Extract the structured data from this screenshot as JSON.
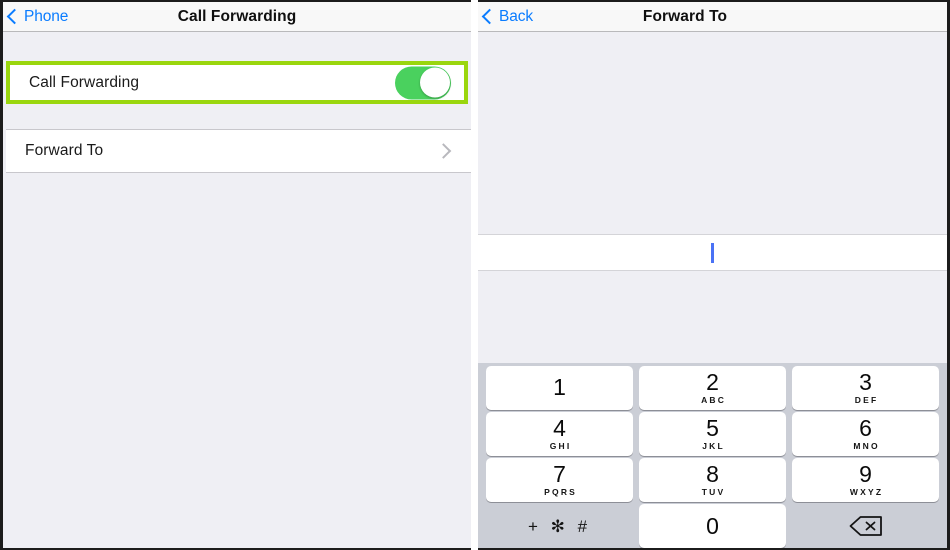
{
  "left_panel": {
    "nav": {
      "back_label": "Phone",
      "back_icon": "chevron-left-icon",
      "title": "Call Forwarding"
    },
    "rows": {
      "call_forwarding": {
        "label": "Call Forwarding",
        "toggle_state": "on",
        "toggle_color": "#4ad15e",
        "highlight_color": "#9ad60e"
      },
      "forward_to": {
        "label": "Forward To",
        "disclosure_icon": "chevron-right-icon"
      }
    }
  },
  "right_panel": {
    "nav": {
      "back_label": "Back",
      "back_icon": "chevron-left-icon",
      "title": "Forward To"
    },
    "number_field": {
      "value": "",
      "caret_visible": true,
      "caret_color": "#4a72f5"
    },
    "keypad": {
      "rows": [
        [
          {
            "digit": "1",
            "letters": ""
          },
          {
            "digit": "2",
            "letters": "ABC"
          },
          {
            "digit": "3",
            "letters": "DEF"
          }
        ],
        [
          {
            "digit": "4",
            "letters": "GHI"
          },
          {
            "digit": "5",
            "letters": "JKL"
          },
          {
            "digit": "6",
            "letters": "MNO"
          }
        ],
        [
          {
            "digit": "7",
            "letters": "PQRS"
          },
          {
            "digit": "8",
            "letters": "TUV"
          },
          {
            "digit": "9",
            "letters": "WXYZ"
          }
        ]
      ],
      "bottom_row": {
        "symbols_label": "+ ✻ #",
        "zero_digit": "0",
        "delete_icon": "backspace-icon"
      }
    }
  }
}
